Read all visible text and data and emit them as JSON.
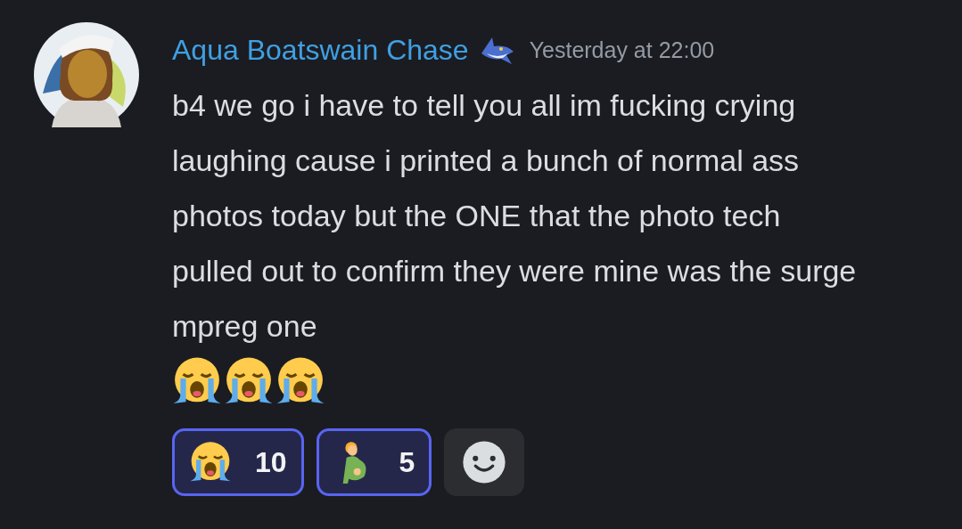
{
  "message": {
    "author": "Aqua Boatswain Chase",
    "timestamp": "Yesterday at 22:00",
    "text": "b4 we go i have to tell you all im fucking crying laughing cause i printed a bunch of normal ass photos today but the ONE that the photo tech pulled out to confirm they were mine was the surge mpreg one",
    "trailing_emoji": [
      {
        "kind": "crying"
      },
      {
        "kind": "crying"
      },
      {
        "kind": "crying"
      }
    ]
  },
  "reactions": [
    {
      "kind": "crying",
      "count": "10",
      "selected": true
    },
    {
      "kind": "pregnant",
      "count": "5",
      "selected": true
    }
  ]
}
